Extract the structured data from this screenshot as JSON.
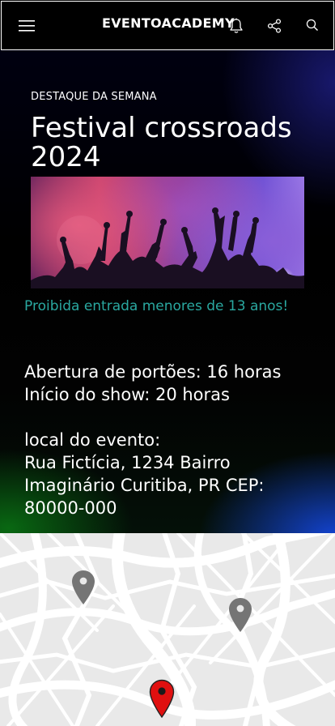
{
  "header": {
    "brand": "EVENTOACADEMY",
    "icons": [
      "menu-icon",
      "bell-icon",
      "share-icon",
      "search-icon"
    ]
  },
  "hero": {
    "kicker": "DESTAQUE DA SEMANA",
    "title": "Festival crossroads 2024",
    "warning": "Proibida entrada menores de 13 anos!",
    "gates": "Abertura de portões: 16 horas",
    "show": "Início do show: 20 horas",
    "location_label": "local do evento:",
    "address": "Rua Fictícia, 1234 Bairro Imaginário Curitiba, PR CEP: 80000-000"
  },
  "colors": {
    "warning": "#2aa8a0",
    "primary_pin": "#e01010",
    "secondary_pin": "#757575",
    "map_background": "#e9e9e9"
  },
  "map": {
    "pins": [
      "secondary-pin",
      "secondary-pin",
      "selected-pin"
    ]
  }
}
